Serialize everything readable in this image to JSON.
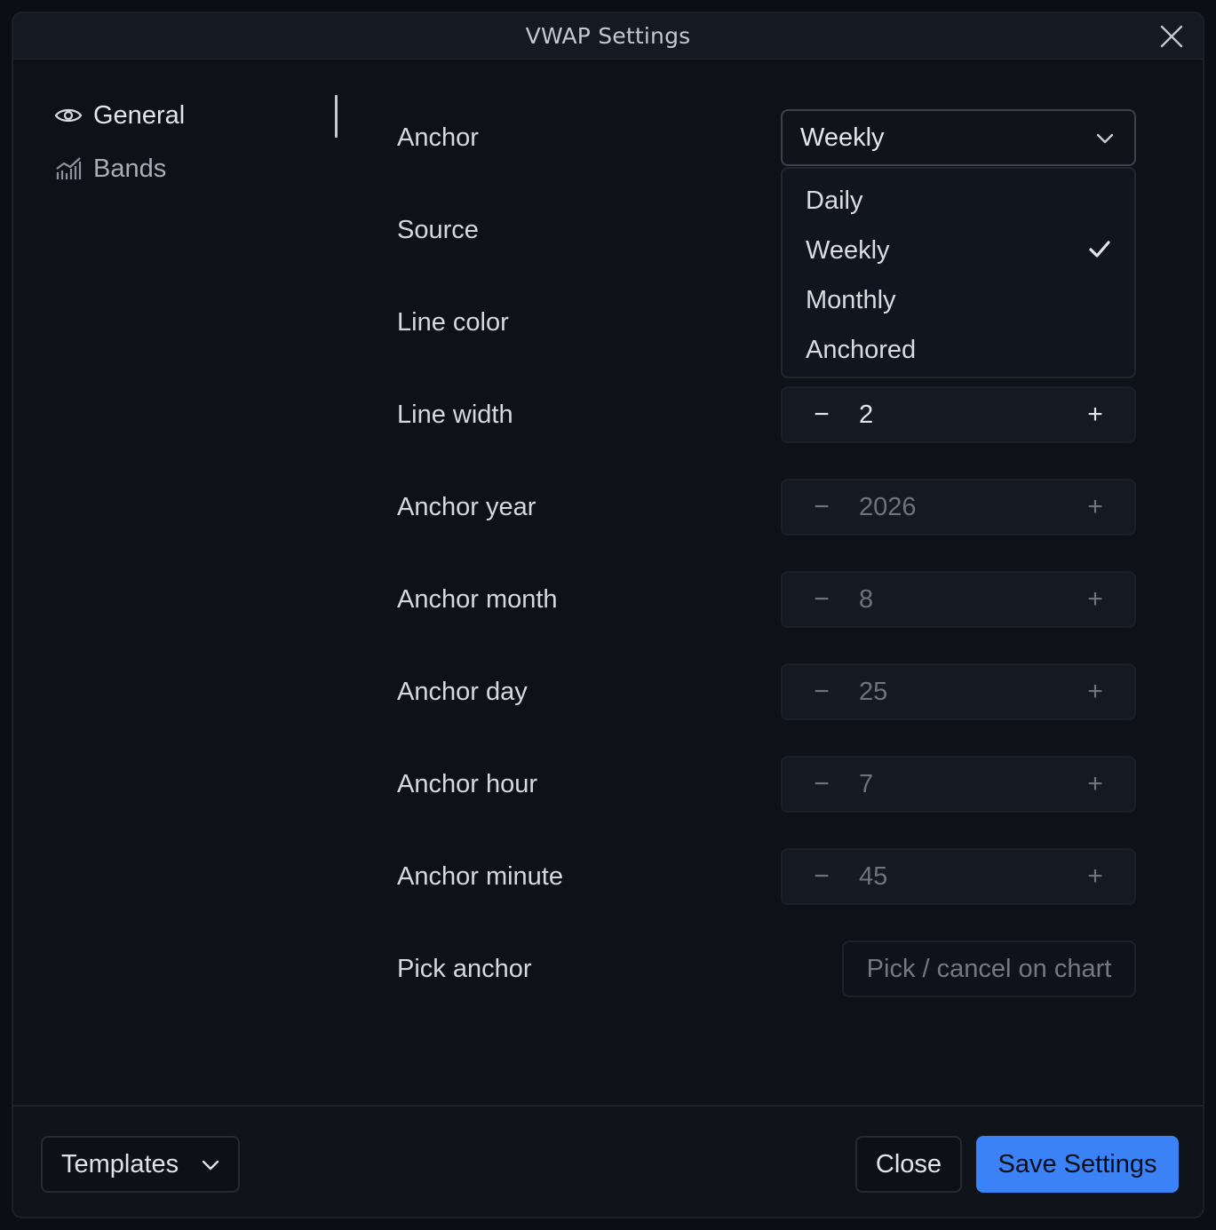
{
  "dialog": {
    "title": "VWAP Settings"
  },
  "sidebar": {
    "items": [
      {
        "label": "General",
        "icon": "eye-icon",
        "active": true
      },
      {
        "label": "Bands",
        "icon": "chart-bars-icon",
        "active": false
      }
    ]
  },
  "fields": {
    "anchor": {
      "label": "Anchor",
      "value": "Weekly"
    },
    "source": {
      "label": "Source"
    },
    "line_color": {
      "label": "Line color"
    },
    "line_width": {
      "label": "Line width",
      "value": "2",
      "minus": "−",
      "plus": "+"
    },
    "anchor_year": {
      "label": "Anchor year",
      "value": "2026",
      "minus": "−",
      "plus": "+"
    },
    "anchor_month": {
      "label": "Anchor month",
      "value": "8",
      "minus": "−",
      "plus": "+"
    },
    "anchor_day": {
      "label": "Anchor day",
      "value": "25",
      "minus": "−",
      "plus": "+"
    },
    "anchor_hour": {
      "label": "Anchor hour",
      "value": "7",
      "minus": "−",
      "plus": "+"
    },
    "anchor_minute": {
      "label": "Anchor minute",
      "value": "45",
      "minus": "−",
      "plus": "+"
    },
    "pick_anchor": {
      "label": "Pick anchor",
      "button": "Pick / cancel on chart"
    }
  },
  "anchor_menu": {
    "options": [
      "Daily",
      "Weekly",
      "Monthly",
      "Anchored"
    ],
    "selected": "Weekly"
  },
  "footer": {
    "templates": "Templates",
    "close": "Close",
    "save": "Save Settings"
  },
  "colors": {
    "accent": "#3b82f6",
    "background": "#0e1118"
  }
}
